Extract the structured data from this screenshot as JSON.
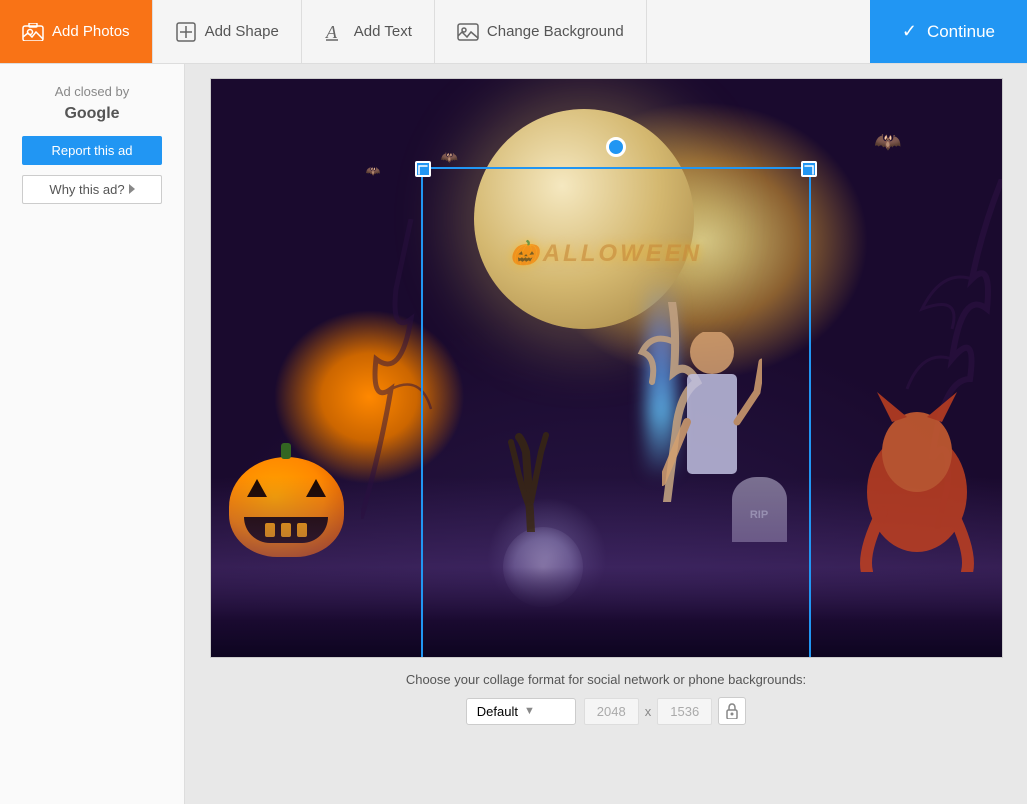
{
  "toolbar": {
    "add_photos_label": "Add Photos",
    "add_shape_label": "Add Shape",
    "add_text_label": "Add Text",
    "change_bg_label": "Change Background",
    "continue_label": "Continue"
  },
  "sidebar": {
    "ad_closed_line1": "Ad closed by",
    "ad_closed_company": "Google",
    "report_btn_label": "Report this ad",
    "why_ad_label": "Why this ad?"
  },
  "canvas": {
    "halloween_text": "HALLOWEEN"
  },
  "format_bar": {
    "label": "Choose your collage format for social network or phone backgrounds:",
    "format_default": "Default",
    "width": "2048",
    "x_label": "x",
    "height": "1536"
  },
  "icons": {
    "add_photos": "🖼",
    "add_shape": "⬡",
    "add_text": "A",
    "change_bg": "🖼",
    "checkmark": "✓",
    "lock": "🔒"
  }
}
